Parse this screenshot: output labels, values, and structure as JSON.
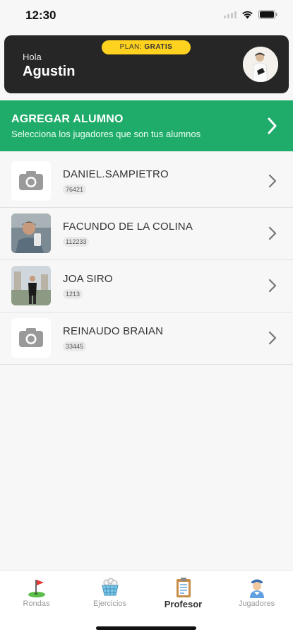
{
  "status_bar": {
    "time": "12:30"
  },
  "header": {
    "plan_prefix": "PLAN:",
    "plan_value": "GRATIS",
    "greeting": "Hola",
    "user_name": "Agustin",
    "avatar_icon": "user-avatar"
  },
  "add_student": {
    "title": "AGREGAR ALUMNO",
    "subtitle": "Selecciona los jugadores que son tus alumnos",
    "accent": "#1fac6a"
  },
  "students": [
    {
      "name": "DANIEL.SAMPIETRO",
      "code": "76421",
      "photo": "camera-placeholder-icon"
    },
    {
      "name": "FACUNDO DE LA COLINA",
      "code": "112233",
      "photo": "profile-photo"
    },
    {
      "name": "JOA SIRO",
      "code": "1213",
      "photo": "profile-photo"
    },
    {
      "name": "REINAUDO BRAIAN",
      "code": "33445",
      "photo": "camera-placeholder-icon"
    }
  ],
  "tabs": [
    {
      "label": "Rondas",
      "icon": "golf-flag-icon",
      "active": false
    },
    {
      "label": "Ejercicios",
      "icon": "ball-basket-icon",
      "active": false
    },
    {
      "label": "Profesor",
      "icon": "clipboard-icon",
      "active": true
    },
    {
      "label": "Jugadores",
      "icon": "golfer-icon",
      "active": false
    }
  ],
  "colors": {
    "header_bg": "#262626",
    "plan_badge": "#ffd21f",
    "green": "#1fac6a"
  }
}
